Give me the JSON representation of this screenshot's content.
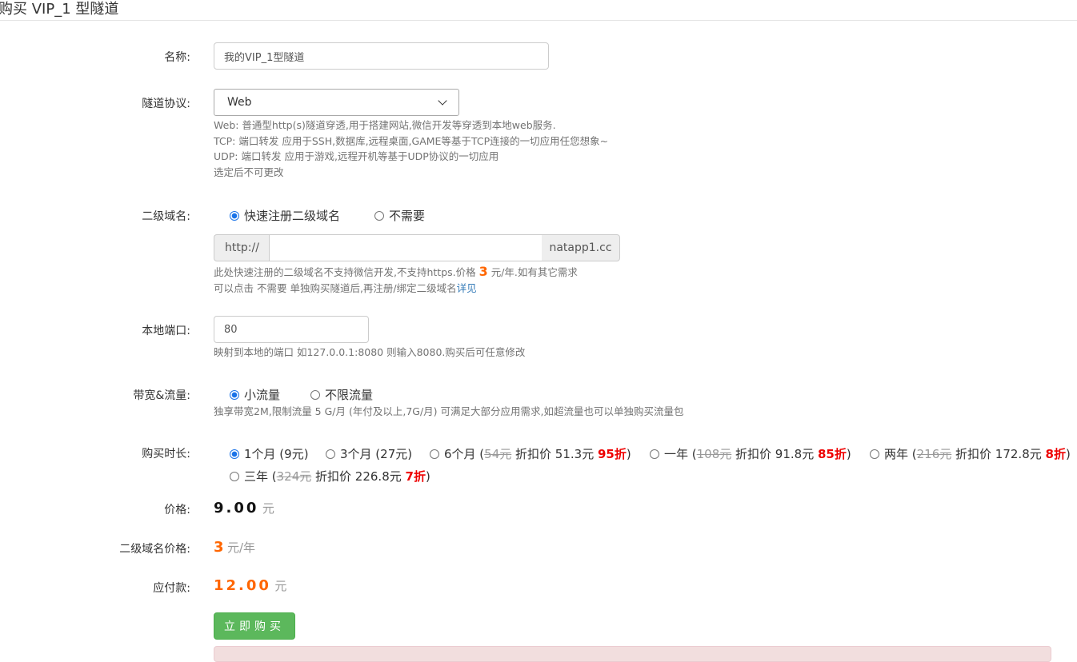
{
  "page": {
    "title": "购买 VIP_1 型隧道"
  },
  "form": {
    "name": {
      "label": "名称:",
      "value": "我的VIP_1型隧道"
    },
    "protocol": {
      "label": "隧道协议:",
      "selected": "Web",
      "help": [
        "Web: 普通型http(s)隧道穿透,用于搭建网站,微信开发等穿透到本地web服务.",
        "TCP: 端口转发 应用于SSH,数据库,远程桌面,GAME等基于TCP连接的一切应用任您想象~",
        "UDP: 端口转发 应用于游戏,远程开机等基于UDP协议的一切应用",
        "选定后不可更改"
      ]
    },
    "subdomain": {
      "label": "二级域名:",
      "options": [
        {
          "label": "快速注册二级域名",
          "checked": true
        },
        {
          "label": "不需要",
          "checked": false
        }
      ],
      "prefix": "http://",
      "value": "",
      "suffix": "natapp1.cc",
      "help_pre": "此处快速注册的二级域名不支持微信开发,不支持https.价格 ",
      "help_price": "3",
      "help_post": " 元/年.如有其它需求",
      "help_line2": "可以点击 不需要 单独购买隧道后,再注册/绑定二级域名",
      "help_link": "详见"
    },
    "local_port": {
      "label": "本地端口:",
      "value": "80",
      "help": "映射到本地的端口 如127.0.0.1:8080 则输入8080.购买后可任意修改"
    },
    "bandwidth": {
      "label": "带宽&流量:",
      "options": [
        {
          "label": "小流量",
          "checked": true
        },
        {
          "label": "不限流量",
          "checked": false
        }
      ],
      "help": "独享带宽2M,限制流量 5 G/月 (年付及以上,7G/月) 可满足大部分应用需求,如超流量也可以单独购买流量包"
    },
    "duration": {
      "label": "购买时长:",
      "options": [
        {
          "label": "1个月 (9元)",
          "checked": true
        },
        {
          "label": "3个月 (27元)",
          "checked": false
        },
        {
          "pre": "6个月 (",
          "orig": "54元",
          "mid": " 折扣价 51.3元 ",
          "disc": "95折",
          "post": ")",
          "checked": false
        },
        {
          "pre": "一年 (",
          "orig": "108元",
          "mid": " 折扣价 91.8元 ",
          "disc": "85折",
          "post": ")",
          "checked": false
        },
        {
          "pre": "两年 (",
          "orig": "216元",
          "mid": " 折扣价 172.8元 ",
          "disc": "8折",
          "post": ")",
          "checked": false
        },
        {
          "pre": "三年 (",
          "orig": "324元",
          "mid": " 折扣价 226.8元 ",
          "disc": "7折",
          "post": ")",
          "checked": false
        }
      ]
    },
    "price": {
      "label": "价格:",
      "value": "9.00",
      "unit": "元"
    },
    "domain_price": {
      "label": "二级域名价格:",
      "value": "3",
      "unit": "元/年"
    },
    "total": {
      "label": "应付款:",
      "value": "12.00",
      "unit": "元"
    },
    "buy_button": "立即购买"
  }
}
